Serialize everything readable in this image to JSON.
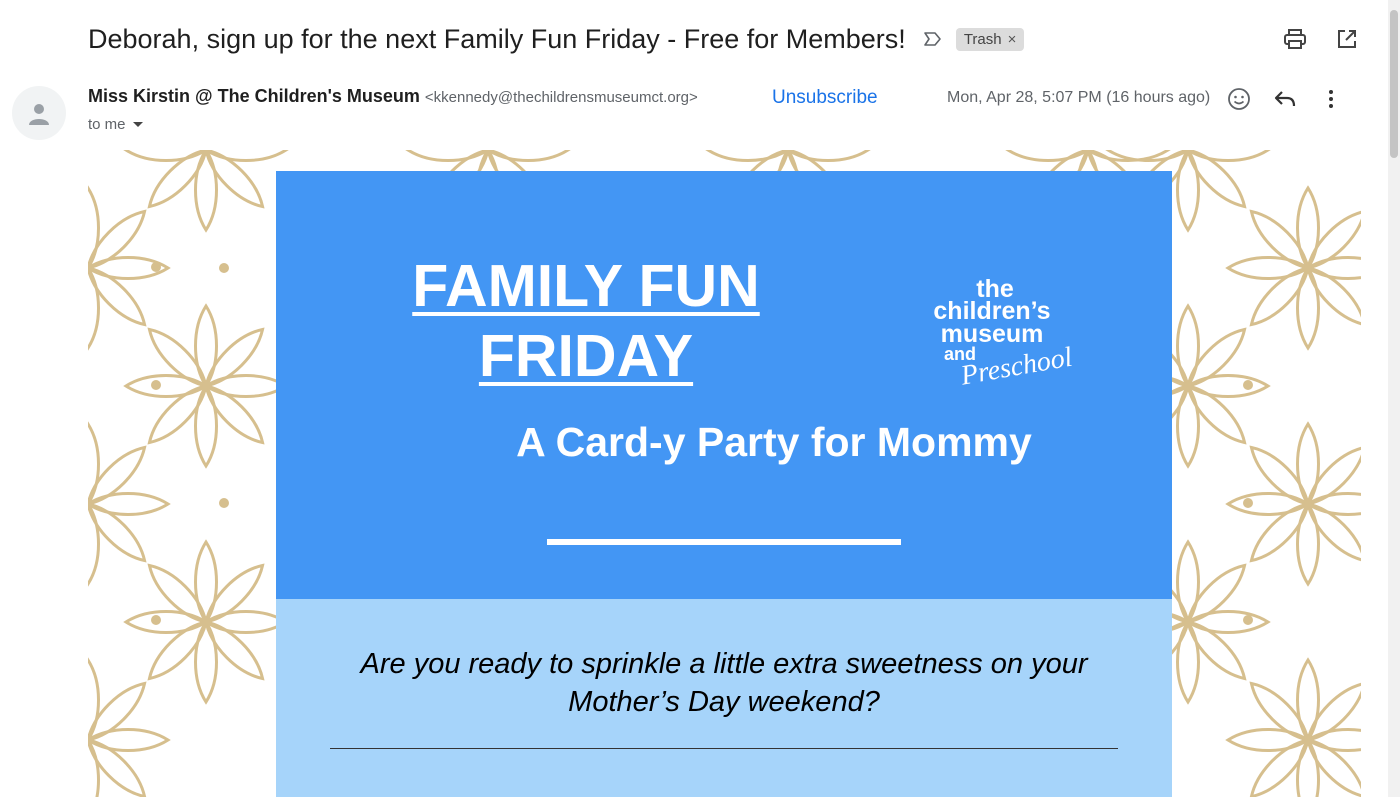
{
  "subject": "Deborah, sign up for the next Family Fun Friday - Free for Members!",
  "label": "Trash",
  "label_remove": "×",
  "sender": {
    "name": "Miss Kirstin @ The Children's Museum",
    "email": "<kkennedy@thechildrensmuseumct.org>",
    "to": "to me"
  },
  "unsubscribe": "Unsubscribe",
  "date": "Mon, Apr 28, 5:07 PM (16 hours ago)",
  "icons": {
    "importance": "importance-marker-icon",
    "print": "print-icon",
    "new_window": "open-in-new-window-icon",
    "avatar": "person-icon",
    "emoji": "emoji-reaction-icon",
    "reply": "reply-icon",
    "more": "more-vert-icon",
    "to_dropdown": "chevron-down-icon"
  },
  "email": {
    "title_line1": "FAMILY FUN",
    "title_line2": "FRIDAY",
    "logo": [
      "the",
      "children’s",
      "museum",
      "and",
      "Preschool"
    ],
    "subtitle": "A Card-y Party for Mommy",
    "intro_line1": "Are you ready to sprinkle a little extra sweetness on your",
    "intro_line2": "Mother’s Day weekend?"
  },
  "colors": {
    "hero_blue": "#4396f4",
    "light_blue": "#a6d4fa",
    "pattern_gold": "#d6bf8e",
    "link_blue": "#1a73e8"
  }
}
